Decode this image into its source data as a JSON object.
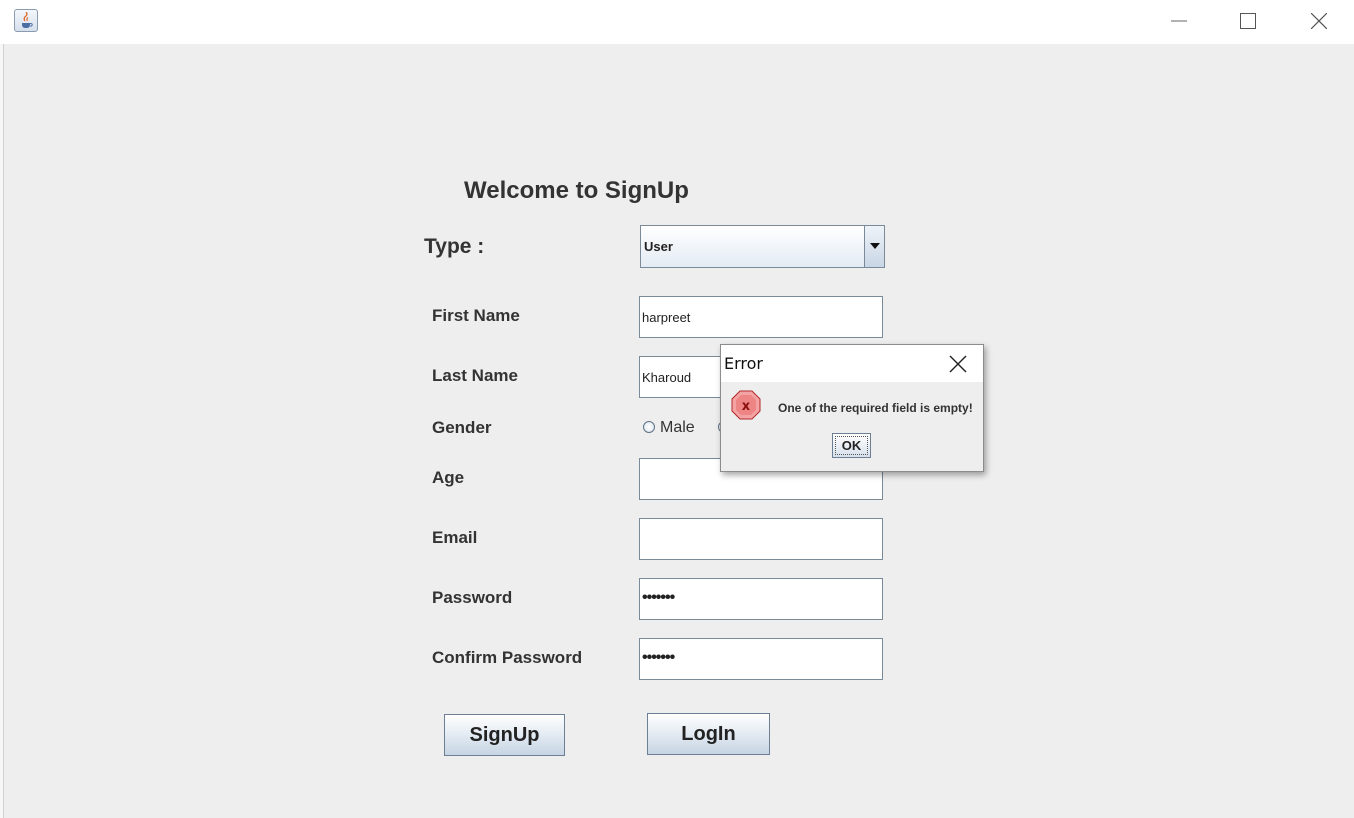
{
  "window": {
    "icon": "java-cup-icon",
    "controls": {
      "minimize": "minimize-icon",
      "maximize": "maximize-icon",
      "close": "close-icon"
    }
  },
  "form": {
    "title": "Welcome to SignUp",
    "type_label": "Type :",
    "type_value": "User",
    "first_name_label": "First Name",
    "first_name_value": "harpreet",
    "last_name_label": "Last Name",
    "last_name_value": "Kharoud",
    "gender_label": "Gender",
    "gender_option_male": "Male",
    "age_label": "Age",
    "age_value": "",
    "email_label": "Email",
    "email_value": "",
    "password_label": "Password",
    "password_value": "•••••••",
    "confirm_password_label": "Confirm Password",
    "confirm_password_value": "•••••••",
    "signup_button": "SignUp",
    "login_button": "LogIn"
  },
  "dialog": {
    "title": "Error",
    "message": "One of the required field is empty!",
    "ok_button": "OK",
    "icon": "error-icon"
  },
  "colors": {
    "background": "#eeeeee",
    "error_red": "#d9363e"
  }
}
